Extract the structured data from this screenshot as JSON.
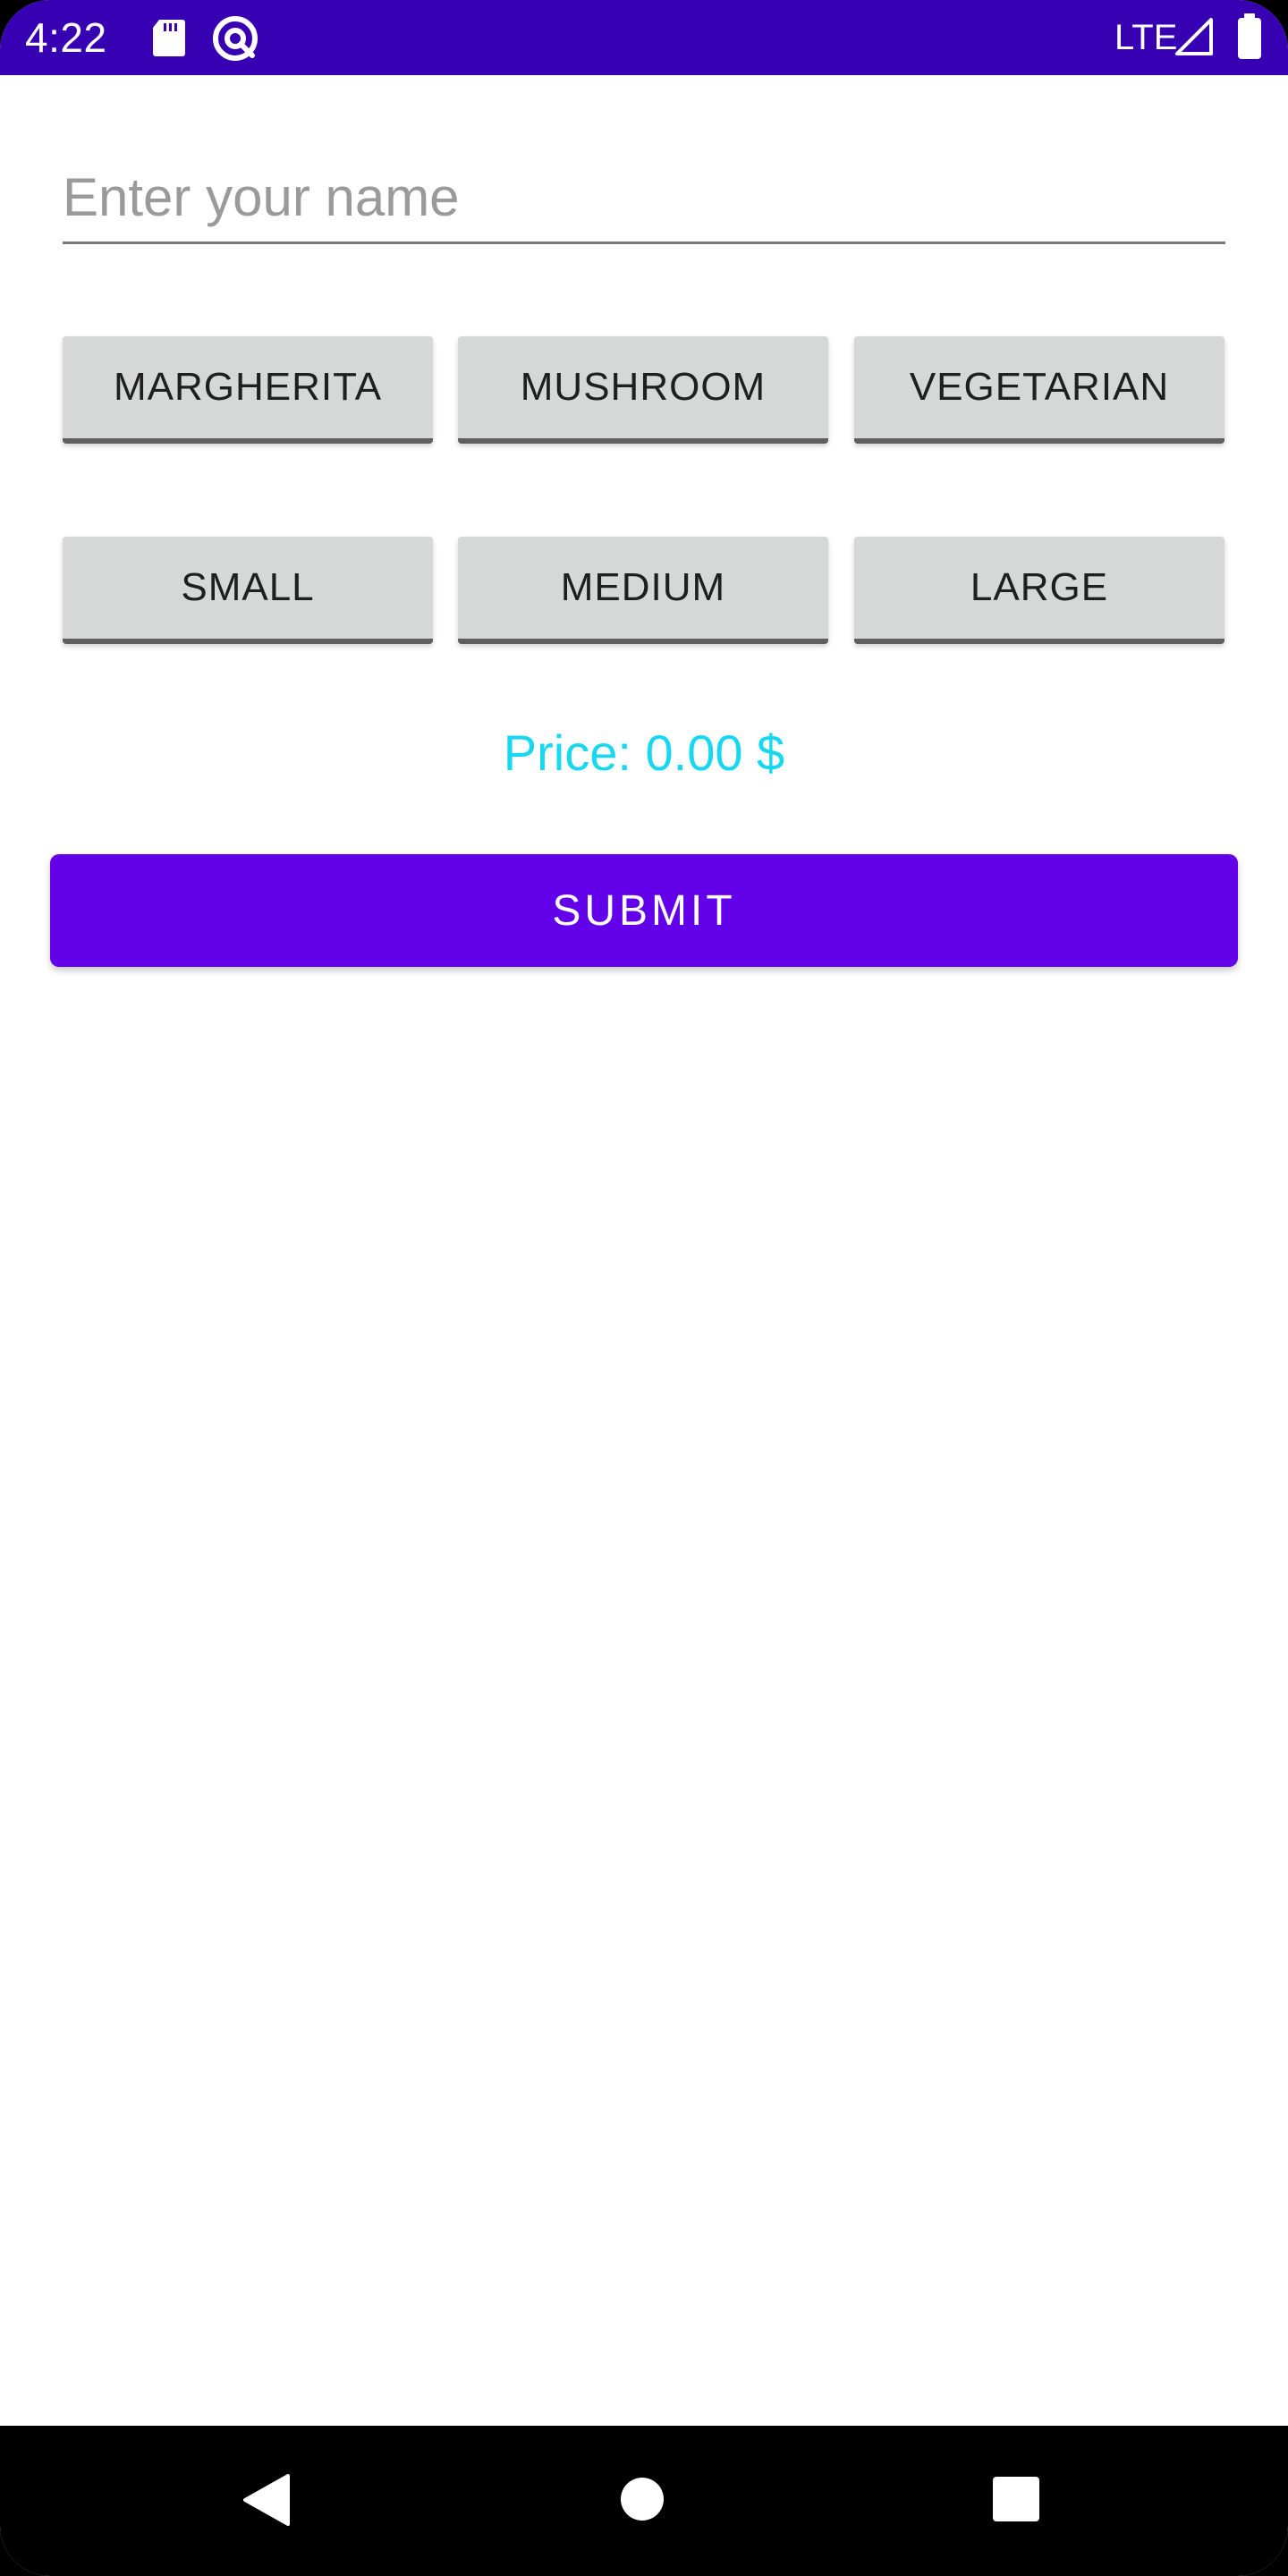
{
  "status_bar": {
    "time": "4:22",
    "network": "LTE",
    "icons": [
      "sd-card-icon",
      "at-sign-icon",
      "signal-icon",
      "battery-icon"
    ],
    "background_color": "#3700b3"
  },
  "form": {
    "name_placeholder": "Enter your name",
    "name_value": ""
  },
  "pizza_types": [
    {
      "label": "MARGHERITA"
    },
    {
      "label": "MUSHROOM"
    },
    {
      "label": "VEGETARIAN"
    }
  ],
  "sizes": [
    {
      "label": "SMALL"
    },
    {
      "label": "MEDIUM"
    },
    {
      "label": "LARGE"
    }
  ],
  "price": {
    "text": "Price: 0.00 $",
    "color": "#18d8f0"
  },
  "submit": {
    "label": "SUBMIT",
    "color": "#6200ea"
  },
  "nav_bar": {
    "icons": [
      "back-icon",
      "home-icon",
      "recents-icon"
    ]
  }
}
